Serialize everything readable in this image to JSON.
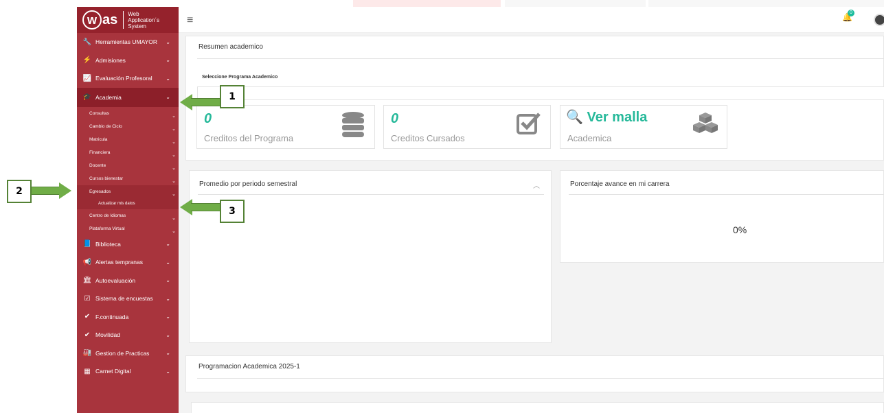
{
  "logo": {
    "w": "w",
    "as": "as",
    "sub1": "Web",
    "sub2": "Application´s",
    "sub3": "System"
  },
  "sidebar": {
    "items": [
      {
        "icon": "🔧",
        "label": "Herramientas UMAYOR"
      },
      {
        "icon": "⚡",
        "label": "Admisiones"
      },
      {
        "icon": "📈",
        "label": "Evaluación Profesoral"
      },
      {
        "icon": "🎓",
        "label": "Academia"
      }
    ],
    "sub_items": [
      {
        "label": "Consultas"
      },
      {
        "label": "Cambio de Ciclo"
      },
      {
        "label": "Matricula"
      },
      {
        "label": "Financiera"
      },
      {
        "label": "Docente"
      },
      {
        "label": "Cursos bienestar"
      },
      {
        "label": "Egresados"
      }
    ],
    "subsub_item": "Actualizar mis datos",
    "sub_items2": [
      {
        "label": "Centro de Idiomas"
      },
      {
        "label": "Plataforma Virtual"
      }
    ],
    "items2": [
      {
        "icon": "📘",
        "label": "Biblioteca"
      },
      {
        "icon": "📢",
        "label": "Alertas tempranas"
      },
      {
        "icon": "🏛",
        "label": "Autoevaluación"
      },
      {
        "icon": "☑",
        "label": "Sistema de encuestas"
      },
      {
        "icon": "✔",
        "label": "F.continuada"
      },
      {
        "icon": "✔",
        "label": "Movilidad"
      },
      {
        "icon": "🏭",
        "label": "Gestion de Practicas"
      },
      {
        "icon": "▦",
        "label": "Carnet Digital"
      }
    ]
  },
  "header": {
    "menu_icon": "≡",
    "notification_count": "0"
  },
  "resumen": {
    "title": "Resumen academico",
    "select_label": "Seleccione Programa Academico",
    "stats": [
      {
        "value": "0",
        "label": "Creditos del Programa"
      },
      {
        "value": "0",
        "label": "Creditos Cursados"
      }
    ],
    "malla_link": "Ver malla",
    "malla_label": "Academica"
  },
  "promedio": {
    "title": "Promedio por periodo semestral"
  },
  "avance": {
    "title": "Porcentaje avance en mi carrera",
    "value": "0%"
  },
  "programacion": {
    "title": "Programacion Academica 2025-1"
  },
  "annotations": [
    "1",
    "2",
    "3"
  ],
  "colors": {
    "sidebar": "#a8343d",
    "accent": "#26b99a",
    "arrow": "#70ad47"
  }
}
